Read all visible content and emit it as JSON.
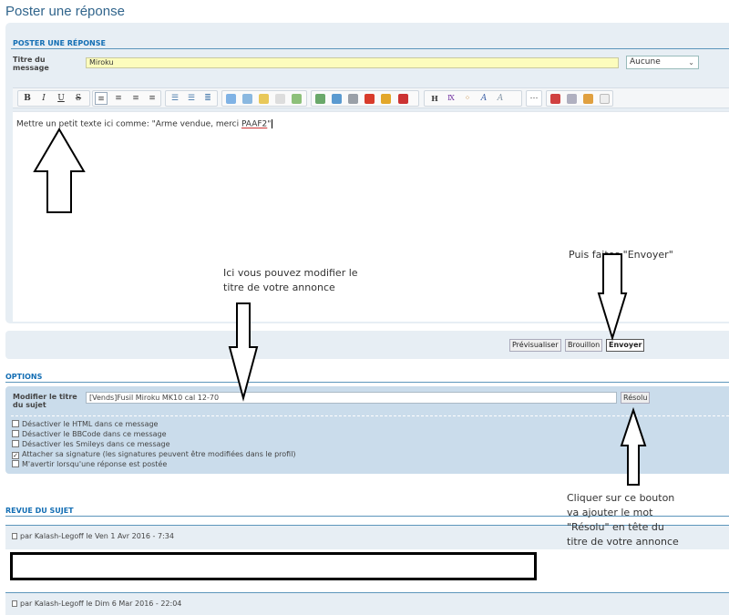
{
  "page": {
    "title": "Poster une réponse"
  },
  "post": {
    "section_title": "POSTER UNE RÉPONSE",
    "title_label_l1": "Titre du",
    "title_label_l2": "message",
    "title_value": "Miroku",
    "icon_select": "Aucune",
    "editor_text_before": "Mettre un petit texte ici comme: \"Arme vendue, merci ",
    "editor_text_underlined": "PAAF2",
    "editor_text_after": "\""
  },
  "toolbar": {
    "bold": "B",
    "italic": "I",
    "underline": "U",
    "strike": "S",
    "headline": "H"
  },
  "actions": {
    "preview": "Prévisualiser",
    "draft": "Brouillon",
    "send": "Envoyer"
  },
  "options": {
    "section_title": "OPTIONS",
    "subject_label_l1": "Modifier le titre",
    "subject_label_l2": "du sujet",
    "subject_value": "[Vends]Fusil Miroku MK10 cal 12-70",
    "resolved_button": "Résolu",
    "checkboxes": [
      {
        "label": "Désactiver le HTML dans ce message",
        "checked": false
      },
      {
        "label": "Désactiver le BBCode dans ce message",
        "checked": false
      },
      {
        "label": "Désactiver les Smileys dans ce message",
        "checked": false
      },
      {
        "label": "Attacher sa signature (les signatures peuvent être modifiées dans le profil)",
        "checked": true
      },
      {
        "label": "M'avertir lorsqu'une réponse est postée",
        "checked": false
      }
    ]
  },
  "review": {
    "section_title": "REVUE DU SUJET",
    "posts": [
      {
        "meta": "par Kalash-Legoff le Ven 1 Avr 2016 - 7:34"
      },
      {
        "meta": "par Kalash-Legoff le Dim 6 Mar 2016 - 22:04"
      }
    ]
  },
  "annotations": {
    "edit_title_l1": "Ici vous pouvez modifier le",
    "edit_title_l2": "titre de votre annonce",
    "send_note": "Puis faites \"Envoyer\"",
    "resolved_l1": "Cliquer sur ce bouton",
    "resolved_l2": "va ajouter le mot",
    "resolved_l3": "\"Résolu\" en tête du",
    "resolved_l4": "titre de votre annonce"
  }
}
